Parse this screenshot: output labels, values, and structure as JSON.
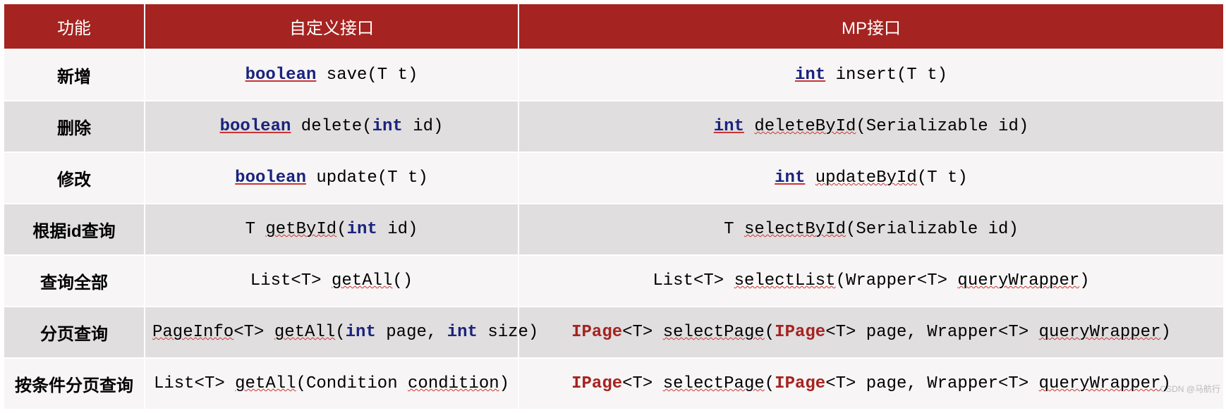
{
  "headers": {
    "feature": "功能",
    "custom": "自定义接口",
    "mp": "MP接口"
  },
  "rows": [
    {
      "feature": [
        {
          "t": "新增"
        }
      ],
      "custom": [
        {
          "t": "boolean",
          "cls": "kw"
        },
        {
          "t": " save(T t)"
        }
      ],
      "mp": [
        {
          "t": "int",
          "cls": "kw"
        },
        {
          "t": " insert(T t)"
        }
      ]
    },
    {
      "feature": [
        {
          "t": "删除"
        }
      ],
      "custom": [
        {
          "t": "boolean",
          "cls": "kw"
        },
        {
          "t": " delete("
        },
        {
          "t": "int",
          "cls": "kw2"
        },
        {
          "t": " id)"
        }
      ],
      "mp": [
        {
          "t": "int",
          "cls": "kw"
        },
        {
          "t": " "
        },
        {
          "t": "deleteById",
          "cls": "chk"
        },
        {
          "t": "(Serializable id)"
        }
      ]
    },
    {
      "feature": [
        {
          "t": "修改"
        }
      ],
      "custom": [
        {
          "t": "boolean",
          "cls": "kw"
        },
        {
          "t": " update(T t)"
        }
      ],
      "mp": [
        {
          "t": "int",
          "cls": "kw"
        },
        {
          "t": " "
        },
        {
          "t": "updateById",
          "cls": "chk"
        },
        {
          "t": "(T t)"
        }
      ]
    },
    {
      "feature": [
        {
          "t": "根据"
        },
        {
          "t": "id",
          "cls": "bold"
        },
        {
          "t": "查询"
        }
      ],
      "custom": [
        {
          "t": "T "
        },
        {
          "t": "getById",
          "cls": "chk"
        },
        {
          "t": "("
        },
        {
          "t": "int",
          "cls": "kw2"
        },
        {
          "t": " id)"
        }
      ],
      "mp": [
        {
          "t": "T "
        },
        {
          "t": "selectById",
          "cls": "chk"
        },
        {
          "t": "(Serializable id)"
        }
      ]
    },
    {
      "feature": [
        {
          "t": "查询全部"
        }
      ],
      "custom": [
        {
          "t": "List<T> "
        },
        {
          "t": "getAll",
          "cls": "chk"
        },
        {
          "t": "()"
        }
      ],
      "mp": [
        {
          "t": "List<T> "
        },
        {
          "t": "selectList",
          "cls": "chk"
        },
        {
          "t": "(Wrapper<T> "
        },
        {
          "t": "queryWrapper",
          "cls": "chk"
        },
        {
          "t": ")"
        }
      ]
    },
    {
      "feature": [
        {
          "t": "分页查询"
        }
      ],
      "custom": [
        {
          "t": "PageInfo",
          "cls": "chk"
        },
        {
          "t": "<T> "
        },
        {
          "t": "getAll",
          "cls": "chk"
        },
        {
          "t": "("
        },
        {
          "t": "int",
          "cls": "kw2"
        },
        {
          "t": " page, "
        },
        {
          "t": "int",
          "cls": "kw2"
        },
        {
          "t": " size)"
        }
      ],
      "mp": [
        {
          "t": "IPage",
          "cls": "err"
        },
        {
          "t": "<T> "
        },
        {
          "t": "selectPage",
          "cls": "chk"
        },
        {
          "t": "("
        },
        {
          "t": "IPage",
          "cls": "err"
        },
        {
          "t": "<T> page, Wrapper<T> "
        },
        {
          "t": "queryWrapper",
          "cls": "chk"
        },
        {
          "t": ")"
        }
      ]
    },
    {
      "feature": [
        {
          "t": "按条件分页查询"
        }
      ],
      "custom": [
        {
          "t": "List<T> "
        },
        {
          "t": "getAll",
          "cls": "chk"
        },
        {
          "t": "(Condition "
        },
        {
          "t": "condition",
          "cls": "chk"
        },
        {
          "t": ")"
        }
      ],
      "mp": [
        {
          "t": "IPage",
          "cls": "err"
        },
        {
          "t": "<T> "
        },
        {
          "t": "selectPage",
          "cls": "chk"
        },
        {
          "t": "("
        },
        {
          "t": "IPage",
          "cls": "err"
        },
        {
          "t": "<T> page, Wrapper<T> "
        },
        {
          "t": "queryWrapper",
          "cls": "chk"
        },
        {
          "t": ")"
        }
      ]
    }
  ],
  "watermark": "CSDN @马航行"
}
